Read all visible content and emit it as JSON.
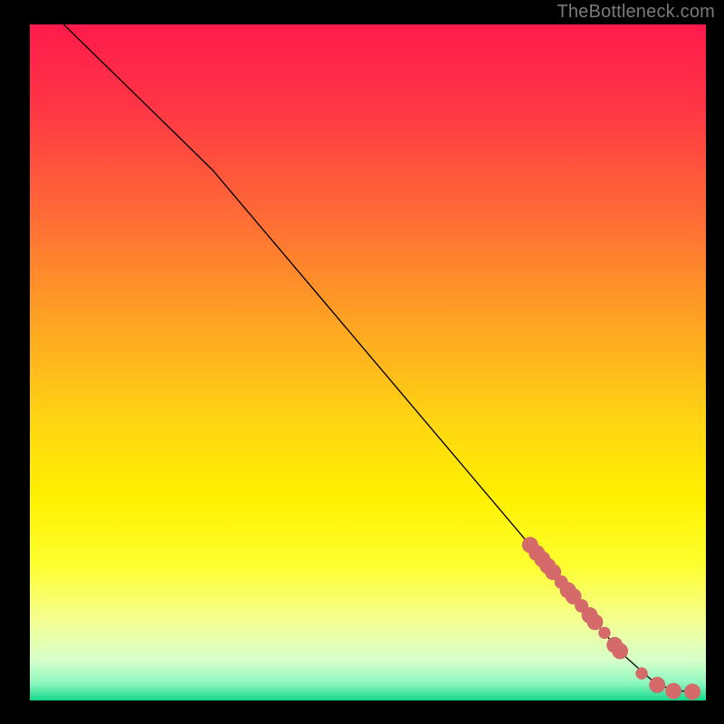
{
  "watermark": "TheBottleneck.com",
  "chart_data": {
    "type": "line",
    "title": "",
    "xlabel": "",
    "ylabel": "",
    "xlim": [
      0,
      100
    ],
    "ylim": [
      0,
      100
    ],
    "background_gradient": {
      "stops": [
        {
          "offset": 0.0,
          "color": "#ff1a4b"
        },
        {
          "offset": 0.12,
          "color": "#ff3545"
        },
        {
          "offset": 0.28,
          "color": "#ff6a36"
        },
        {
          "offset": 0.45,
          "color": "#ffa722"
        },
        {
          "offset": 0.58,
          "color": "#ffd313"
        },
        {
          "offset": 0.7,
          "color": "#fff100"
        },
        {
          "offset": 0.8,
          "color": "#feff2f"
        },
        {
          "offset": 0.88,
          "color": "#f4ff8f"
        },
        {
          "offset": 0.94,
          "color": "#d7ffca"
        },
        {
          "offset": 0.975,
          "color": "#8cf7bf"
        },
        {
          "offset": 1.0,
          "color": "#13d989"
        }
      ]
    },
    "series": [
      {
        "name": "curve",
        "stroke": "#000000",
        "x": [
          5,
          27,
          87.5,
          92,
          95,
          98
        ],
        "y": [
          100,
          78.5,
          7,
          3,
          1.5,
          1.3
        ]
      }
    ],
    "markers": {
      "name": "highlight-dots",
      "fill": "#d46a6a",
      "stroke": "#d46a6a",
      "points": [
        {
          "x": 74.0,
          "y": 23.0,
          "r": 1.2
        },
        {
          "x": 75.0,
          "y": 21.8,
          "r": 1.2
        },
        {
          "x": 75.8,
          "y": 20.9,
          "r": 1.2
        },
        {
          "x": 76.6,
          "y": 19.9,
          "r": 1.2
        },
        {
          "x": 77.4,
          "y": 19.0,
          "r": 1.2
        },
        {
          "x": 78.6,
          "y": 17.5,
          "r": 1.0
        },
        {
          "x": 79.6,
          "y": 16.3,
          "r": 1.2
        },
        {
          "x": 80.4,
          "y": 15.4,
          "r": 1.2
        },
        {
          "x": 81.6,
          "y": 14.0,
          "r": 1.0
        },
        {
          "x": 82.8,
          "y": 12.6,
          "r": 1.2
        },
        {
          "x": 83.6,
          "y": 11.6,
          "r": 1.2
        },
        {
          "x": 85.0,
          "y": 10.0,
          "r": 0.9
        },
        {
          "x": 86.5,
          "y": 8.2,
          "r": 1.2
        },
        {
          "x": 87.3,
          "y": 7.3,
          "r": 1.2
        },
        {
          "x": 90.5,
          "y": 4.0,
          "r": 0.9
        },
        {
          "x": 92.8,
          "y": 2.3,
          "r": 1.2
        },
        {
          "x": 95.2,
          "y": 1.4,
          "r": 1.2
        },
        {
          "x": 98.0,
          "y": 1.3,
          "r": 1.2
        }
      ]
    }
  }
}
